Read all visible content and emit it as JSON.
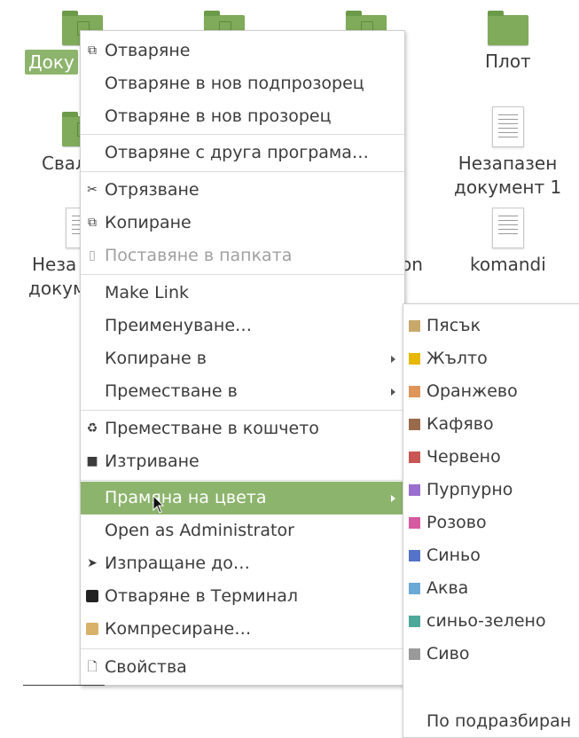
{
  "desktop": {
    "icons": [
      {
        "label": "Доку"
      },
      {
        "label": "Плот"
      },
      {
        "label": "Свал"
      },
      {
        "label_line1": "Незапазен",
        "label_line2": "документ 1"
      },
      {
        "label_line1": "Неза",
        "label_line2": "докум"
      },
      {
        "label": "on"
      },
      {
        "label": "komandi"
      }
    ]
  },
  "context_menu": {
    "items": [
      {
        "label": "Отваряне",
        "icon": "open-icon"
      },
      {
        "label": "Отваряне в нов подпрозорец"
      },
      {
        "label": "Отваряне в нов прозорец"
      },
      {
        "label": "Отваряне с друга програма…"
      },
      {
        "label": "Отрязване",
        "icon": "scissors-icon"
      },
      {
        "label": "Копиране",
        "icon": "copy-icon"
      },
      {
        "label": "Поставяне в папката",
        "icon": "paste-icon",
        "disabled": true
      },
      {
        "label": "Make Link"
      },
      {
        "label": "Преименуване…"
      },
      {
        "label": "Копиране в",
        "submenu": true
      },
      {
        "label": "Преместване в",
        "submenu": true
      },
      {
        "label": "Преместване в кошчето",
        "icon": "trash-icon"
      },
      {
        "label": "Изтриване",
        "icon": "delete-icon"
      },
      {
        "label": "Прамяна на цвета",
        "submenu": true,
        "highlighted": true
      },
      {
        "label": "Open as Administrator"
      },
      {
        "label": "Изпращане до…",
        "icon": "send-icon"
      },
      {
        "label": "Отваряне в Терминал",
        "icon": "terminal-icon"
      },
      {
        "label": "Компресиране…",
        "icon": "archive-icon"
      },
      {
        "label": "Свойства",
        "icon": "properties-icon"
      }
    ]
  },
  "color_submenu": {
    "items": [
      {
        "label": "Пясък",
        "color": "#c8a96b"
      },
      {
        "label": "Жълто",
        "color": "#e6b800"
      },
      {
        "label": "Оранжево",
        "color": "#e0955a"
      },
      {
        "label": "Кафяво",
        "color": "#9a6b4b"
      },
      {
        "label": "Червено",
        "color": "#c95555"
      },
      {
        "label": "Пурпурно",
        "color": "#9a6fd0"
      },
      {
        "label": "Розово",
        "color": "#d65a9f"
      },
      {
        "label": "Синьо",
        "color": "#5573c8"
      },
      {
        "label": "Аква",
        "color": "#6aa9d6"
      },
      {
        "label": "синьо-зелено",
        "color": "#4ea89a"
      },
      {
        "label": "Сиво",
        "color": "#9a9a9a"
      }
    ],
    "default_label": "По подразбиран"
  },
  "colors": {
    "accent": "#8db46d",
    "folder": "#7fab5a"
  }
}
